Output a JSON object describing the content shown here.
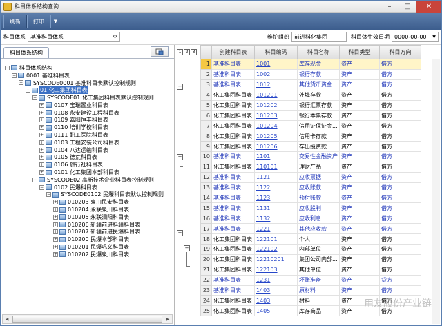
{
  "window": {
    "title": "科目体系结构查询"
  },
  "toolbar": {
    "refresh": "刷新",
    "print": "打印"
  },
  "filters": {
    "system_label": "科目体系",
    "system_value": "基准科目体系",
    "org_label": "维护组织",
    "org_value": "前进科化集团",
    "date_label": "科目体生效日期",
    "date_value": "0000-00-00"
  },
  "left": {
    "tab": "科目体系结构",
    "tree": [
      {
        "level": 0,
        "label": "科目体系结构",
        "toggle": "-",
        "selected": false
      },
      {
        "level": 1,
        "label": "0001 基准科目表",
        "toggle": "-",
        "selected": false
      },
      {
        "level": 2,
        "label": "SYSCODE0001 基准科目表默认控制规则",
        "toggle": "-",
        "selected": false
      },
      {
        "level": 3,
        "label": "01 化工集团科目表",
        "toggle": "-",
        "selected": true
      },
      {
        "level": 4,
        "label": "SYSCODE01 化工集团科目表默认控制规则",
        "toggle": "-",
        "selected": false
      },
      {
        "level": 5,
        "label": "0107 宝瑞置业科目表",
        "toggle": "+",
        "selected": false
      },
      {
        "level": 5,
        "label": "0108 永安建设工程科目表",
        "toggle": "+",
        "selected": false
      },
      {
        "level": 5,
        "label": "0109 嘉阳恒丰科目表",
        "toggle": "+",
        "selected": false
      },
      {
        "level": 5,
        "label": "0110 培训学校科目表",
        "toggle": "+",
        "selected": false
      },
      {
        "level": 5,
        "label": "0111 职工医院科目表",
        "toggle": "+",
        "selected": false
      },
      {
        "level": 5,
        "label": "0103 工程安装公司科目表",
        "toggle": "+",
        "selected": false
      },
      {
        "level": 5,
        "label": "0104 八达运输科目表",
        "toggle": "+",
        "selected": false
      },
      {
        "level": 5,
        "label": "0105 德荒科目表",
        "toggle": "+",
        "selected": false
      },
      {
        "level": 5,
        "label": "0106 旅行社科目表",
        "toggle": "+",
        "selected": false
      },
      {
        "level": 5,
        "label": "0101 化工集团本部科目表",
        "toggle": "+",
        "selected": false
      },
      {
        "level": 4,
        "label": "SYSCODE02 高新技术企业科目表控制规则",
        "toggle": "-",
        "selected": false
      },
      {
        "level": 5,
        "label": "0102 民爆科目表",
        "toggle": "-",
        "selected": false
      },
      {
        "level": 6,
        "label": "SYSCODE0102 民爆科目表默认控制规则",
        "toggle": "-",
        "selected": false
      },
      {
        "level": 7,
        "label": "010203 泉川民安科目表",
        "toggle": "+",
        "selected": false
      },
      {
        "level": 7,
        "label": "010204 永联泉川科目表",
        "toggle": "+",
        "selected": false
      },
      {
        "level": 7,
        "label": "010205 永联泗阳科目表",
        "toggle": "+",
        "selected": false
      },
      {
        "level": 7,
        "label": "010206 新疆前进科疆科目表",
        "toggle": "+",
        "selected": false
      },
      {
        "level": 7,
        "label": "010207 新疆前进民爆科目表",
        "toggle": "+",
        "selected": false
      },
      {
        "level": 7,
        "label": "010200 民爆本部科目表",
        "toggle": "+",
        "selected": false
      },
      {
        "level": 7,
        "label": "010201 民爆巩义科目表",
        "toggle": "+",
        "selected": false
      },
      {
        "level": 7,
        "label": "010202 民爆泉川科目表",
        "toggle": "+",
        "selected": false
      }
    ]
  },
  "grid": {
    "level_buttons": [
      "1",
      "2",
      "3"
    ],
    "columns": [
      "创建科目表",
      "科目编码",
      "科目名称",
      "科目类型",
      "科目方向"
    ],
    "rows": [
      {
        "n": "1",
        "table": "基准科目表",
        "code": "1001",
        "name": "库存现金",
        "type": "资产",
        "dir": "借方",
        "blue": true
      },
      {
        "n": "2",
        "table": "基准科目表",
        "code": "1002",
        "name": "银行存款",
        "type": "资产",
        "dir": "借方",
        "blue": true
      },
      {
        "n": "3",
        "table": "基准科目表",
        "code": "1012",
        "name": "其他货币资金",
        "type": "资产",
        "dir": "借方",
        "blue": true
      },
      {
        "n": "4",
        "table": "化工集团科目表",
        "code": "101201",
        "name": "外埠存款",
        "type": "资产",
        "dir": "借方",
        "blue": false
      },
      {
        "n": "5",
        "table": "化工集团科目表",
        "code": "101202",
        "name": "银行汇票存款",
        "type": "资产",
        "dir": "借方",
        "blue": false
      },
      {
        "n": "6",
        "table": "化工集团科目表",
        "code": "101203",
        "name": "银行本票存款",
        "type": "资产",
        "dir": "借方",
        "blue": false
      },
      {
        "n": "7",
        "table": "化工集团科目表",
        "code": "101204",
        "name": "信用证保证金...",
        "type": "资产",
        "dir": "借方",
        "blue": false
      },
      {
        "n": "8",
        "table": "化工集团科目表",
        "code": "101205",
        "name": "信用卡存款",
        "type": "资产",
        "dir": "借方",
        "blue": false
      },
      {
        "n": "9",
        "table": "化工集团科目表",
        "code": "101206",
        "name": "存出投资款",
        "type": "资产",
        "dir": "借方",
        "blue": false
      },
      {
        "n": "10",
        "table": "基准科目表",
        "code": "1101",
        "name": "交易性金融资产",
        "type": "资产",
        "dir": "借方",
        "blue": true
      },
      {
        "n": "11",
        "table": "化工集团科目表",
        "code": "110101",
        "name": "理财产品",
        "type": "资产",
        "dir": "借方",
        "blue": false
      },
      {
        "n": "12",
        "table": "基准科目表",
        "code": "1121",
        "name": "应收票据",
        "type": "资产",
        "dir": "借方",
        "blue": true
      },
      {
        "n": "13",
        "table": "基准科目表",
        "code": "1122",
        "name": "应收账款",
        "type": "资产",
        "dir": "借方",
        "blue": true
      },
      {
        "n": "14",
        "table": "基准科目表",
        "code": "1123",
        "name": "预付账款",
        "type": "资产",
        "dir": "借方",
        "blue": true
      },
      {
        "n": "15",
        "table": "基准科目表",
        "code": "1131",
        "name": "应收股利",
        "type": "资产",
        "dir": "借方",
        "blue": true
      },
      {
        "n": "16",
        "table": "基准科目表",
        "code": "1132",
        "name": "应收利息",
        "type": "资产",
        "dir": "借方",
        "blue": true
      },
      {
        "n": "17",
        "table": "基准科目表",
        "code": "1221",
        "name": "其他应收款",
        "type": "资产",
        "dir": "借方",
        "blue": true
      },
      {
        "n": "18",
        "table": "化工集团科目表",
        "code": "122101",
        "name": "个人",
        "type": "资产",
        "dir": "借方",
        "blue": false
      },
      {
        "n": "19",
        "table": "化工集团科目表",
        "code": "122102",
        "name": "内部单位",
        "type": "资产",
        "dir": "借方",
        "blue": false
      },
      {
        "n": "20",
        "table": "化工集团科目表",
        "code": "12210201",
        "name": "集团公司内部...",
        "type": "资产",
        "dir": "借方",
        "blue": false
      },
      {
        "n": "21",
        "table": "化工集团科目表",
        "code": "122103",
        "name": "其他单位",
        "type": "资产",
        "dir": "借方",
        "blue": false
      },
      {
        "n": "22",
        "table": "基准科目表",
        "code": "1231",
        "name": "坏账准备",
        "type": "资产",
        "dir": "贷方",
        "blue": true
      },
      {
        "n": "23",
        "table": "基准科目表",
        "code": "1403",
        "name": "原材料",
        "type": "资产",
        "dir": "借方",
        "blue": true
      },
      {
        "n": "24",
        "table": "化工集团科目表",
        "code": "1403",
        "name": "材料",
        "type": "资产",
        "dir": "借方",
        "blue": false
      },
      {
        "n": "25",
        "table": "化工集团科目表",
        "code": "1405",
        "name": "库存商品",
        "type": "资产",
        "dir": "借方",
        "blue": false
      }
    ]
  },
  "watermark": "用友股份产业链"
}
